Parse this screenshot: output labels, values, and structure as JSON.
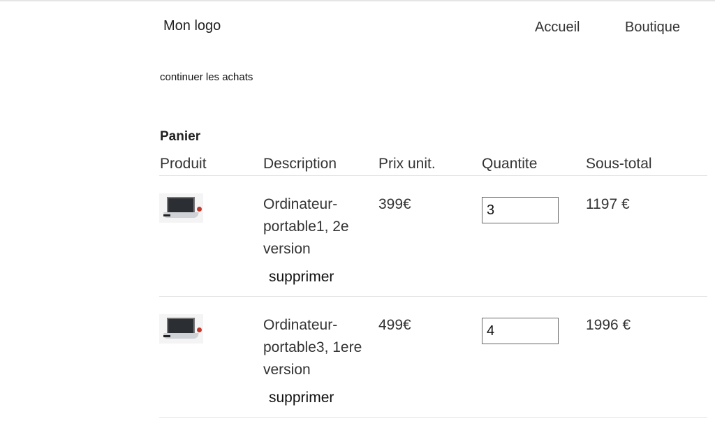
{
  "header": {
    "logo": "Mon logo",
    "nav": [
      "Accueil",
      "Boutique"
    ]
  },
  "continue_link": "continuer les achats",
  "cart": {
    "title": "Panier",
    "columns": [
      "Produit",
      "Description",
      "Prix unit.",
      "Quantite",
      "Sous-total"
    ],
    "items": [
      {
        "description": "Ordinateur-portable1, 2e version",
        "price": "399€",
        "quantity": "3",
        "subtotal": "1197 €",
        "remove_label": "supprimer",
        "image_icon": "laptop-photo"
      },
      {
        "description": "Ordinateur-portable3, 1ere version",
        "price": "499€",
        "quantity": "4",
        "subtotal": "1996 €",
        "remove_label": "supprimer",
        "image_icon": "laptop-photo"
      }
    ]
  }
}
